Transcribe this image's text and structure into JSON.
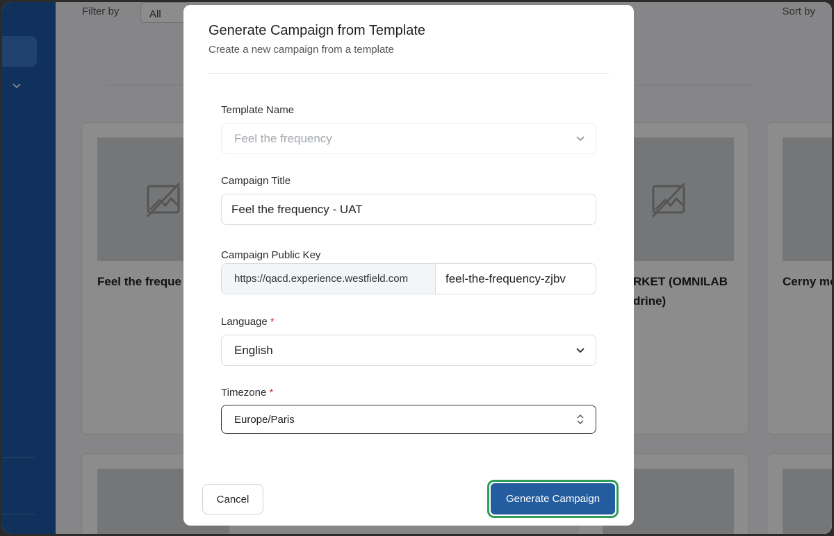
{
  "background": {
    "filter_label": "Filter by",
    "filter_value": "All",
    "sort_label": "Sort by",
    "cards_row1": [
      {
        "title": "Feel the freque"
      },
      {
        "title": "RKET (OMNILAB",
        "title_line2": "drine)"
      },
      {
        "title": "Cerny mo"
      }
    ]
  },
  "modal": {
    "title": "Generate Campaign from Template",
    "subtitle": "Create a new campaign from a template",
    "template_name": {
      "label": "Template Name",
      "value": "Feel the frequency"
    },
    "campaign_title": {
      "label": "Campaign Title",
      "value": "Feel the frequency - UAT"
    },
    "public_key": {
      "label": "Campaign Public Key",
      "prefix": "https://qacd.experience.westfield.com",
      "value": "feel-the-frequency-zjbv"
    },
    "language": {
      "label": "Language",
      "required_mark": "*",
      "value": "English"
    },
    "timezone": {
      "label": "Timezone",
      "required_mark": "*",
      "value": "Europe/Paris"
    },
    "cancel_label": "Cancel",
    "generate_label": "Generate Campaign"
  },
  "colors": {
    "sidebar": "#1d5aa7",
    "primary_button": "#245ca0",
    "focus_ring": "#2e9d59",
    "required": "#dd3333"
  }
}
